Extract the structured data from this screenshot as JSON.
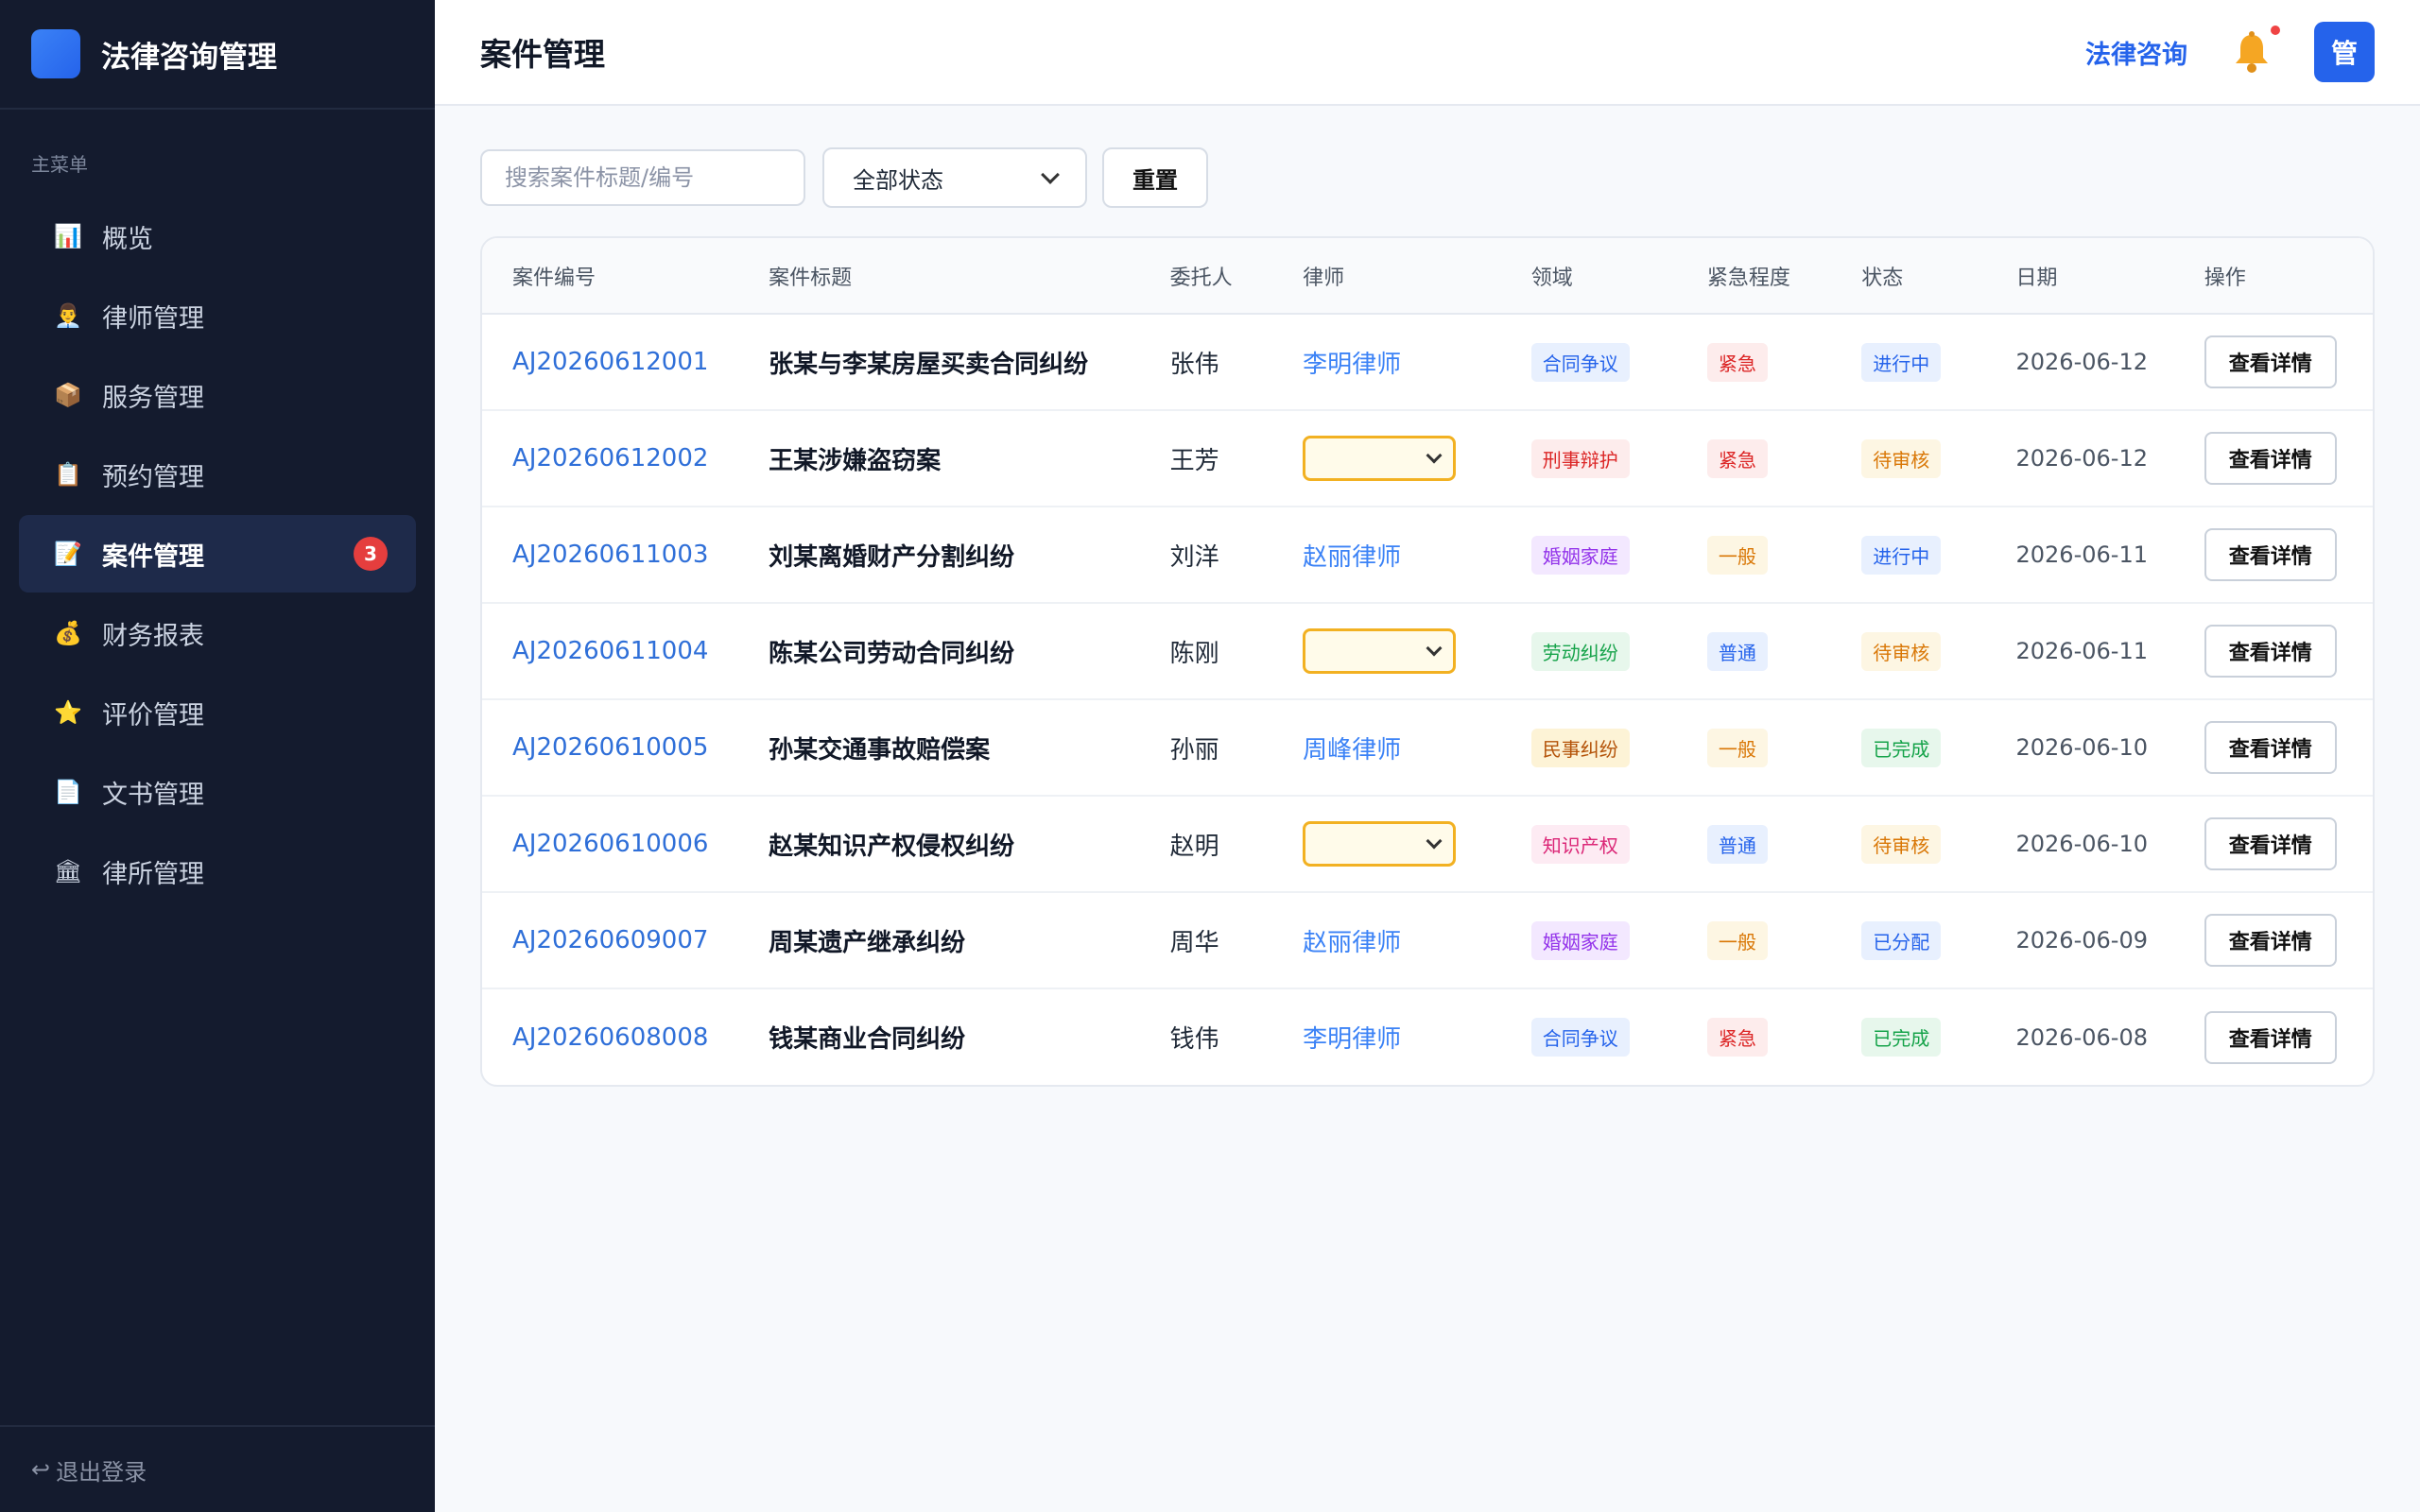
{
  "brand": {
    "title": "法律咨询管理"
  },
  "sidebar": {
    "section_label": "主菜单",
    "items": [
      {
        "label": "概览",
        "icon": "chart-icon",
        "glyph": "📊",
        "active": false
      },
      {
        "label": "律师管理",
        "icon": "lawyer-icon",
        "glyph": "👨‍💼",
        "active": false
      },
      {
        "label": "服务管理",
        "icon": "package-icon",
        "glyph": "📦",
        "active": false
      },
      {
        "label": "预约管理",
        "icon": "clipboard-icon",
        "glyph": "📋",
        "active": false
      },
      {
        "label": "案件管理",
        "icon": "memo-icon",
        "glyph": "📝",
        "active": true,
        "badge": "3"
      },
      {
        "label": "财务报表",
        "icon": "money-bag-icon",
        "glyph": "💰",
        "active": false
      },
      {
        "label": "评价管理",
        "icon": "star-icon",
        "glyph": "⭐",
        "active": false
      },
      {
        "label": "文书管理",
        "icon": "document-icon",
        "glyph": "📄",
        "active": false
      },
      {
        "label": "律所管理",
        "icon": "bank-icon",
        "glyph": "🏛",
        "active": false
      }
    ],
    "logout_label": "退出登录"
  },
  "header": {
    "title": "案件管理",
    "link_label": "法律咨询",
    "avatar_label": "管"
  },
  "filters": {
    "search_placeholder": "搜索案件标题/编号",
    "status_selected": "全部状态",
    "reset_label": "重置"
  },
  "table": {
    "columns": [
      "案件编号",
      "案件标题",
      "委托人",
      "律师",
      "领域",
      "紧急程度",
      "状态",
      "日期",
      "操作"
    ],
    "action_label": "查看详情",
    "rows": [
      {
        "id": "AJ20260612001",
        "title": "张某与李某房屋买卖合同纠纷",
        "client": "张伟",
        "lawyer": "李明律师",
        "field": "合同争议",
        "urgency": "紧急",
        "status": "进行中",
        "date": "2026-06-12"
      },
      {
        "id": "AJ20260612002",
        "title": "王某涉嫌盗窃案",
        "client": "王芳",
        "lawyer": "",
        "field": "刑事辩护",
        "urgency": "紧急",
        "status": "待审核",
        "date": "2026-06-12"
      },
      {
        "id": "AJ20260611003",
        "title": "刘某离婚财产分割纠纷",
        "client": "刘洋",
        "lawyer": "赵丽律师",
        "field": "婚姻家庭",
        "urgency": "一般",
        "status": "进行中",
        "date": "2026-06-11"
      },
      {
        "id": "AJ20260611004",
        "title": "陈某公司劳动合同纠纷",
        "client": "陈刚",
        "lawyer": "",
        "field": "劳动纠纷",
        "urgency": "普通",
        "status": "待审核",
        "date": "2026-06-11"
      },
      {
        "id": "AJ20260610005",
        "title": "孙某交通事故赔偿案",
        "client": "孙丽",
        "lawyer": "周峰律师",
        "field": "民事纠纷",
        "urgency": "一般",
        "status": "已完成",
        "date": "2026-06-10"
      },
      {
        "id": "AJ20260610006",
        "title": "赵某知识产权侵权纠纷",
        "client": "赵明",
        "lawyer": "",
        "field": "知识产权",
        "urgency": "普通",
        "status": "待审核",
        "date": "2026-06-10"
      },
      {
        "id": "AJ20260609007",
        "title": "周某遗产继承纠纷",
        "client": "周华",
        "lawyer": "赵丽律师",
        "field": "婚姻家庭",
        "urgency": "一般",
        "status": "已分配",
        "date": "2026-06-09"
      },
      {
        "id": "AJ20260608008",
        "title": "钱某商业合同纠纷",
        "client": "钱伟",
        "lawyer": "李明律师",
        "field": "合同争议",
        "urgency": "紧急",
        "status": "已完成",
        "date": "2026-06-08"
      }
    ]
  },
  "colors": {
    "accent": "#2563eb",
    "sidebar_bg": "#141b2e",
    "tags": {
      "合同争议": {
        "fg": "#2563eb",
        "bg": "#e8f0fe"
      },
      "刑事辩护": {
        "fg": "#dc2626",
        "bg": "#fdecec"
      },
      "婚姻家庭": {
        "fg": "#9333ea",
        "bg": "#f3e8ff"
      },
      "劳动纠纷": {
        "fg": "#16a34a",
        "bg": "#e7f7ec"
      },
      "民事纠纷": {
        "fg": "#b45309",
        "bg": "#fdf3d6"
      },
      "知识产权": {
        "fg": "#db2777",
        "bg": "#fdebf3"
      },
      "紧急": {
        "fg": "#dc2626",
        "bg": "#fdecec"
      },
      "一般": {
        "fg": "#d97706",
        "bg": "#fdf6e3"
      },
      "普通": {
        "fg": "#2563eb",
        "bg": "#e8f0fe"
      },
      "进行中": {
        "fg": "#2563eb",
        "bg": "#e8f0fe"
      },
      "待审核": {
        "fg": "#d97706",
        "bg": "#fdf6e3"
      },
      "已完成": {
        "fg": "#16a34a",
        "bg": "#e7f7ec"
      },
      "已分配": {
        "fg": "#2563eb",
        "bg": "#e8f0fe"
      }
    }
  }
}
